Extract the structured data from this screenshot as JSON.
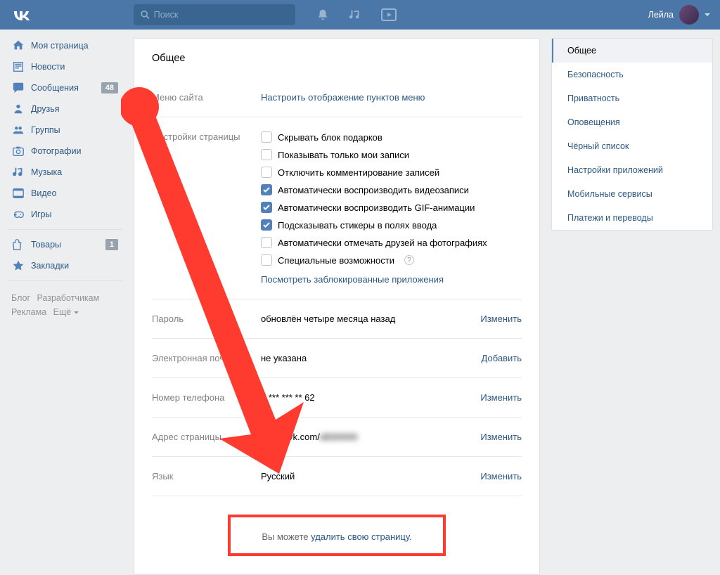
{
  "header": {
    "search_placeholder": "Поиск",
    "user_name": "Лейла"
  },
  "left_nav": {
    "items": [
      {
        "icon": "home",
        "label": "Моя страница"
      },
      {
        "icon": "news",
        "label": "Новости"
      },
      {
        "icon": "msg",
        "label": "Сообщения",
        "badge": "48"
      },
      {
        "icon": "friends",
        "label": "Друзья"
      },
      {
        "icon": "groups",
        "label": "Группы"
      },
      {
        "icon": "photo",
        "label": "Фотографии"
      },
      {
        "icon": "music",
        "label": "Музыка"
      },
      {
        "icon": "video",
        "label": "Видео"
      },
      {
        "icon": "games",
        "label": "Игры"
      }
    ],
    "items2": [
      {
        "icon": "goods",
        "label": "Товары",
        "badge": "1"
      },
      {
        "icon": "star",
        "label": "Закладки"
      }
    ],
    "footer": {
      "blog": "Блог",
      "dev": "Разработчикам",
      "ads": "Реклама",
      "more": "Ещё"
    }
  },
  "settings": {
    "title": "Общее",
    "menu_row": {
      "label": "Меню сайта",
      "action": "Настроить отображение пунктов меню"
    },
    "page_row": {
      "label": "Настройки страницы",
      "checkboxes": [
        {
          "checked": false,
          "label": "Скрывать блок подарков"
        },
        {
          "checked": false,
          "label": "Показывать только мои записи"
        },
        {
          "checked": false,
          "label": "Отключить комментирование записей"
        },
        {
          "checked": true,
          "label": "Автоматически воспроизводить видеозаписи"
        },
        {
          "checked": true,
          "label": "Автоматически воспроизводить GIF-анимации"
        },
        {
          "checked": true,
          "label": "Подсказывать стикеры в полях ввода"
        },
        {
          "checked": false,
          "label": "Автоматически отмечать друзей на фотографиях"
        },
        {
          "checked": false,
          "label": "Специальные возможности",
          "help": true
        }
      ],
      "blocked_link": "Посмотреть заблокированные приложения"
    },
    "password_row": {
      "label": "Пароль",
      "value": "обновлён четыре месяца назад",
      "action": "Изменить"
    },
    "email_row": {
      "label": "Электронная почта",
      "value": "не указана",
      "action": "Добавить"
    },
    "phone_row": {
      "label": "Номер телефона",
      "value": "7 *** *** ** 62",
      "action": "Изменить"
    },
    "url_row": {
      "label": "Адрес страницы",
      "prefix": "https://vk.com/",
      "suffix": "id000000",
      "action": "Изменить"
    },
    "lang_row": {
      "label": "Язык",
      "value": "Русский",
      "action": "Изменить"
    },
    "delete": {
      "prefix": "Вы можете ",
      "link": "удалить свою страницу."
    }
  },
  "right_tabs": [
    {
      "label": "Общее",
      "active": true
    },
    {
      "label": "Безопасность"
    },
    {
      "label": "Приватность"
    },
    {
      "label": "Оповещения"
    },
    {
      "label": "Чёрный список"
    },
    {
      "label": "Настройки приложений"
    },
    {
      "label": "Мобильные сервисы"
    },
    {
      "label": "Платежи и переводы"
    }
  ]
}
